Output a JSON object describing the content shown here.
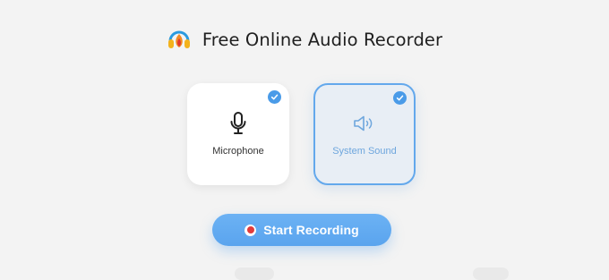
{
  "app": {
    "title": "Free Online Audio Recorder",
    "logo_icon": "headphones-flame-logo-icon"
  },
  "sources": [
    {
      "label": "Microphone",
      "icon": "microphone-icon",
      "checked": true,
      "selected": false
    },
    {
      "label": "System Sound",
      "icon": "speaker-icon",
      "checked": true,
      "selected": true
    }
  ],
  "actions": {
    "start_label": "Start Recording",
    "record_icon": "record-dot-icon"
  },
  "colors": {
    "background": "#f3f3f3",
    "accent": "#5aa4ee",
    "check": "#4a9be8",
    "selected_border": "#63a8ec",
    "record_dot": "#e23b3b"
  }
}
